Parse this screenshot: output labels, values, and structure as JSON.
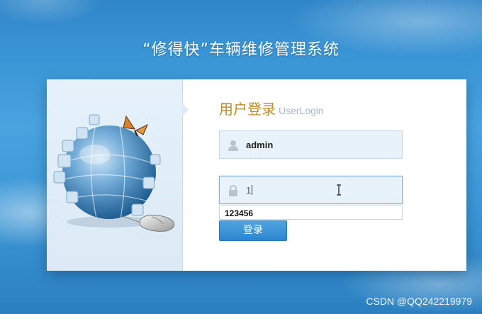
{
  "header": {
    "title": "“修得快”车辆维修管理系统"
  },
  "login": {
    "title": "用户登录",
    "subtitle": "UserLogin",
    "username": {
      "value": "admin",
      "icon": "user-icon"
    },
    "password": {
      "value": "1",
      "icon": "lock-icon"
    },
    "autocomplete_suggestion": "123456",
    "submit_label": "登录"
  },
  "watermark": "CSDN @QQ242219979",
  "colors": {
    "accent": "#2d86cf",
    "title_gold": "#c08a2a",
    "field_bg": "#e8f2fa"
  }
}
